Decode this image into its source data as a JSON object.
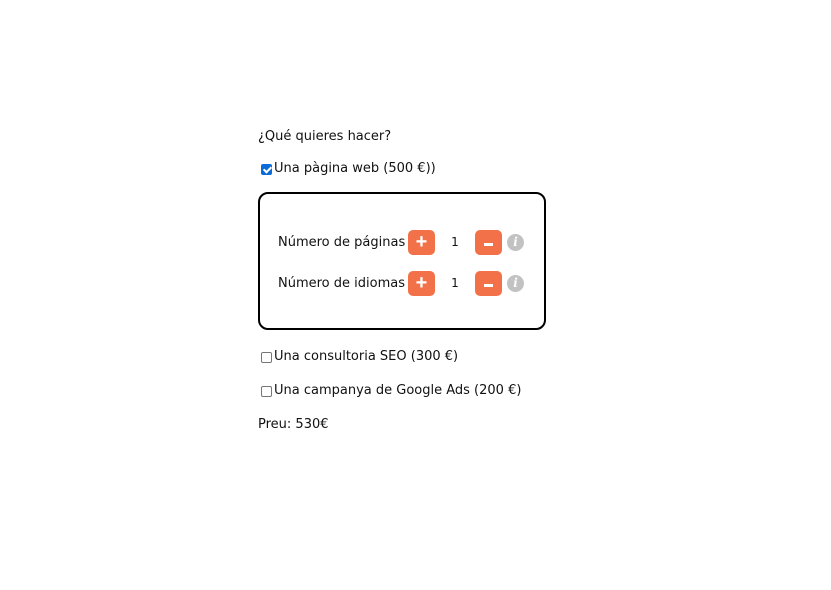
{
  "form": {
    "question": "¿Qué quieres hacer?",
    "options": [
      {
        "label": "Una pàgina web (500 €))",
        "checked": true
      },
      {
        "label": "Una consultoria SEO (300 €)",
        "checked": false
      },
      {
        "label": "Una campanya de Google Ads (200 €)",
        "checked": false
      }
    ],
    "web_panel": {
      "pages": {
        "label": "Número de páginas",
        "value": "1"
      },
      "languages": {
        "label": "Número de idiomas",
        "value": "1"
      },
      "plus_symbol": "+",
      "info_symbol": "i"
    },
    "price_text": "Preu: 530€"
  },
  "colors": {
    "accent": "#f27148",
    "info": "#c2c2c2",
    "checkbox_checked": "#0b6cd9",
    "panel_border": "#000000"
  },
  "icons": {
    "plus": "plus-icon",
    "minus": "minus-icon",
    "info": "info-icon"
  }
}
